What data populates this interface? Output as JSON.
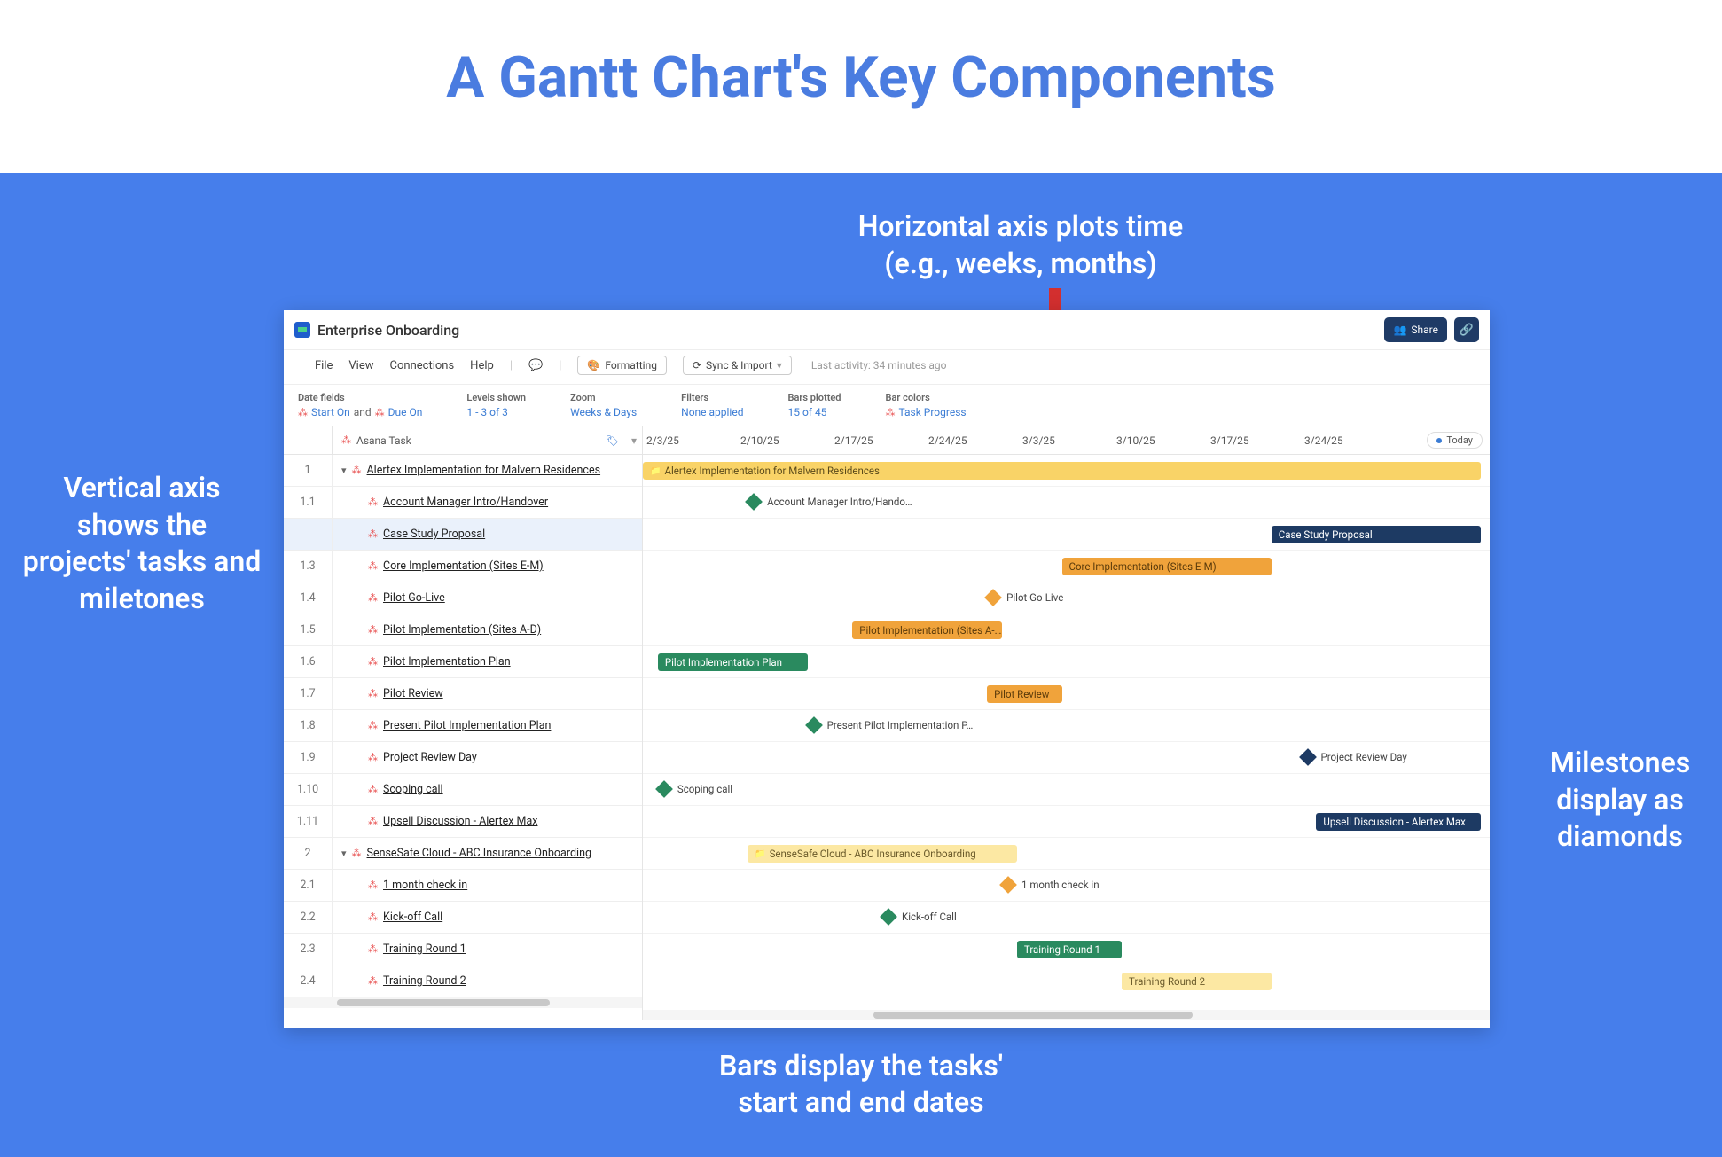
{
  "title": "A Gantt Chart's Key Components",
  "annotations": {
    "top": "Horizontal axis plots time\n(e.g., weeks, months)",
    "left": "Vertical axis shows the projects' tasks and miletones",
    "right": "Milestones display as diamonds",
    "bottom": "Bars display the tasks'\nstart and end dates"
  },
  "header": {
    "app_title": "Enterprise Onboarding",
    "share": "Share"
  },
  "menubar": {
    "items": [
      "File",
      "View",
      "Connections",
      "Help"
    ],
    "formatting": "Formatting",
    "sync": "Sync & Import",
    "last_activity_label": "Last activity:",
    "last_activity_value": "34 minutes ago"
  },
  "filters": {
    "date_fields": {
      "label": "Date fields",
      "value_a": "Start On",
      "and": "and",
      "value_b": "Due On"
    },
    "levels": {
      "label": "Levels shown",
      "value": "1 - 3 of 3"
    },
    "zoom": {
      "label": "Zoom",
      "value": "Weeks & Days"
    },
    "filters": {
      "label": "Filters",
      "value": "None applied"
    },
    "bars_plotted": {
      "label": "Bars plotted",
      "value": "15 of 45"
    },
    "bar_colors": {
      "label": "Bar colors",
      "value": "Task Progress"
    }
  },
  "left_header": "Asana Task",
  "today": "Today",
  "dates": [
    "2/3/25",
    "2/10/25",
    "2/17/25",
    "2/24/25",
    "3/3/25",
    "3/10/25",
    "3/17/25",
    "3/24/25"
  ],
  "tasks": [
    {
      "num": "1",
      "name": "Alertex Implementation for Malvern Residences",
      "parent": true
    },
    {
      "num": "1.1",
      "name": "Account Manager Intro/Handover"
    },
    {
      "num": "",
      "name": "Case Study Proposal",
      "sel": true
    },
    {
      "num": "1.3",
      "name": "Core Implementation (Sites E-M)"
    },
    {
      "num": "1.4",
      "name": "Pilot Go-Live"
    },
    {
      "num": "1.5",
      "name": "Pilot Implementation (Sites A-D)"
    },
    {
      "num": "1.6",
      "name": "Pilot Implementation Plan"
    },
    {
      "num": "1.7",
      "name": "Pilot Review"
    },
    {
      "num": "1.8",
      "name": "Present Pilot Implementation Plan"
    },
    {
      "num": "1.9",
      "name": "Project Review Day"
    },
    {
      "num": "1.10",
      "name": "Scoping call"
    },
    {
      "num": "1.11",
      "name": "Upsell Discussion - Alertex Max"
    },
    {
      "num": "2",
      "name": "SenseSafe Cloud - ABC Insurance Onboarding",
      "parent": true
    },
    {
      "num": "2.1",
      "name": "1 month check in"
    },
    {
      "num": "2.2",
      "name": "Kick-off Call"
    },
    {
      "num": "2.3",
      "name": "Training Round 1"
    },
    {
      "num": "2.4",
      "name": "Training Round 2"
    }
  ],
  "chart_data": {
    "type": "gantt",
    "x_axis": {
      "start": "2/3/25",
      "end": "3/31/25",
      "unit": "weeks"
    },
    "rows": [
      {
        "row": 0,
        "kind": "bar",
        "label": "Alertex Implementation for Malvern Residences",
        "start": "2/3/25",
        "end": "3/31/25",
        "color": "yellow",
        "folder": true
      },
      {
        "row": 1,
        "kind": "milestone",
        "label": "Account Manager Intro/Hando…",
        "date": "2/10/25",
        "color": "green"
      },
      {
        "row": 2,
        "kind": "bar",
        "label": "Case Study Proposal",
        "start": "3/17/25",
        "end": "3/31/25",
        "color": "navy"
      },
      {
        "row": 3,
        "kind": "bar",
        "label": "Core Implementation (Sites E-M)",
        "start": "3/3/25",
        "end": "3/17/25",
        "color": "orange"
      },
      {
        "row": 4,
        "kind": "milestone",
        "label": "Pilot Go-Live",
        "date": "2/26/25",
        "color": "orange"
      },
      {
        "row": 5,
        "kind": "bar",
        "label": "Pilot Implementation (Sites A-…",
        "start": "2/17/25",
        "end": "2/27/25",
        "color": "orange"
      },
      {
        "row": 6,
        "kind": "bar",
        "label": "Pilot Implementation Plan",
        "start": "2/4/25",
        "end": "2/14/25",
        "color": "green"
      },
      {
        "row": 7,
        "kind": "bar",
        "label": "Pilot Review",
        "start": "2/26/25",
        "end": "3/3/25",
        "color": "orange"
      },
      {
        "row": 8,
        "kind": "milestone",
        "label": "Present Pilot Implementation P…",
        "date": "2/14/25",
        "color": "green"
      },
      {
        "row": 9,
        "kind": "milestone",
        "label": "Project Review Day",
        "date": "3/19/25",
        "color": "navy"
      },
      {
        "row": 10,
        "kind": "milestone",
        "label": "Scoping call",
        "date": "2/4/25",
        "color": "green"
      },
      {
        "row": 11,
        "kind": "bar",
        "label": "Upsell Discussion - Alertex Max",
        "start": "3/20/25",
        "end": "3/31/25",
        "color": "navy"
      },
      {
        "row": 12,
        "kind": "bar",
        "label": "SenseSafe Cloud - ABC Insurance Onboarding",
        "start": "2/10/25",
        "end": "2/28/25",
        "color": "yellowlt",
        "folder": true
      },
      {
        "row": 13,
        "kind": "milestone",
        "label": "1 month check in",
        "date": "2/27/25",
        "color": "orange"
      },
      {
        "row": 14,
        "kind": "milestone",
        "label": "Kick-off Call",
        "date": "2/19/25",
        "color": "green"
      },
      {
        "row": 15,
        "kind": "bar",
        "label": "Training Round 1",
        "start": "2/28/25",
        "end": "3/7/25",
        "color": "green"
      },
      {
        "row": 16,
        "kind": "bar",
        "label": "Training Round 2",
        "start": "3/7/25",
        "end": "3/17/25",
        "color": "yellowlt"
      }
    ]
  }
}
